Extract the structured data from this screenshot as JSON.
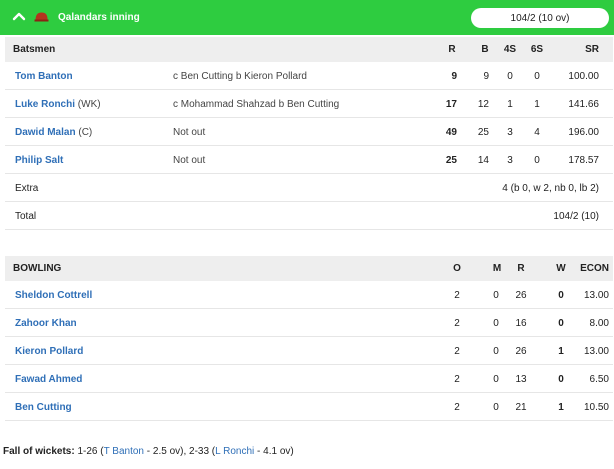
{
  "header": {
    "team": "Qalandars inning",
    "score": "104/2 (10 ov)",
    "colors": {
      "bar": "#2ecc40",
      "link": "#2f6fb7"
    }
  },
  "batting": {
    "heading": "Batsmen",
    "columns": [
      "R",
      "B",
      "4S",
      "6S",
      "SR"
    ],
    "rows": [
      {
        "name": "Tom Banton",
        "tag": "",
        "dismissal": "c Ben Cutting b Kieron Pollard",
        "R": "9",
        "B": "9",
        "4S": "0",
        "6S": "0",
        "SR": "100.00"
      },
      {
        "name": "Luke Ronchi",
        "tag": "(WK)",
        "dismissal": "c Mohammad Shahzad b Ben Cutting",
        "R": "17",
        "B": "12",
        "4S": "1",
        "6S": "1",
        "SR": "141.66"
      },
      {
        "name": "Dawid Malan",
        "tag": "(C)",
        "dismissal": "Not out",
        "R": "49",
        "B": "25",
        "4S": "3",
        "6S": "4",
        "SR": "196.00"
      },
      {
        "name": "Philip Salt",
        "tag": "",
        "dismissal": "Not out",
        "R": "25",
        "B": "14",
        "4S": "3",
        "6S": "0",
        "SR": "178.57"
      }
    ],
    "extra_label": "Extra",
    "extra_value": "4 (b 0, w 2, nb 0, lb 2)",
    "total_label": "Total",
    "total_value": "104/2 (10)"
  },
  "bowling": {
    "heading": "BOWLING",
    "columns": [
      "O",
      "M",
      "R",
      "W",
      "ECON"
    ],
    "rows": [
      {
        "name": "Sheldon Cottrell",
        "O": "2",
        "M": "0",
        "R": "26",
        "W": "0",
        "ECON": "13.00"
      },
      {
        "name": "Zahoor Khan",
        "O": "2",
        "M": "0",
        "R": "16",
        "W": "0",
        "ECON": "8.00"
      },
      {
        "name": "Kieron Pollard",
        "O": "2",
        "M": "0",
        "R": "26",
        "W": "1",
        "ECON": "13.00"
      },
      {
        "name": "Fawad Ahmed",
        "O": "2",
        "M": "0",
        "R": "13",
        "W": "0",
        "ECON": "6.50"
      },
      {
        "name": "Ben Cutting",
        "O": "2",
        "M": "0",
        "R": "21",
        "W": "1",
        "ECON": "10.50"
      }
    ]
  },
  "fall_of_wickets": {
    "label": "Fall of wickets:",
    "w1_score": "1-26 (",
    "w1_name": "T Banton",
    "w1_over": " - 2.5 ov), 2-33 (",
    "w2_name": "L Ronchi",
    "w2_over": " - 4.1 ov)"
  }
}
